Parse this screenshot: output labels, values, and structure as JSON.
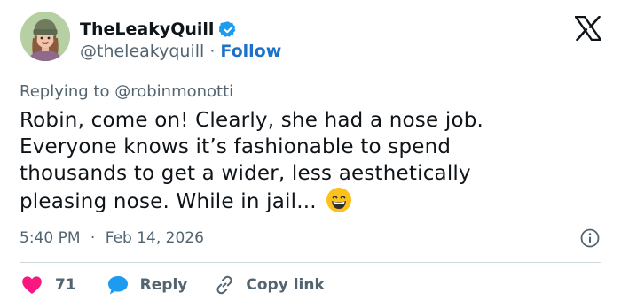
{
  "author": {
    "display_name": "TheLeakyQuill",
    "handle": "@theleakyquill",
    "separator": "·",
    "follow_label": "Follow",
    "verified_color": "#1d9bf0"
  },
  "tweet": {
    "replying_prefix": "Replying to",
    "replying_to": "@robinmonotti",
    "lines": [
      "Robin, come on! Clearly, she had a nose job.",
      "Everyone knows it’s fashionable to spend",
      "thousands to get a wider, less aesthetically",
      "pleasing nose. While in jail..."
    ],
    "emoji": "grinning-face-with-smiling-eyes",
    "time": "5:40 PM",
    "date_separator": "·",
    "date": "Feb 14, 2026"
  },
  "actions": {
    "like_count": "71",
    "reply_label": "Reply",
    "copy_label": "Copy link"
  },
  "colors": {
    "like": "#f91880",
    "reply": "#1d9bf0",
    "follow": "#1d71c6",
    "muted": "#536471",
    "text": "#0f1419"
  }
}
